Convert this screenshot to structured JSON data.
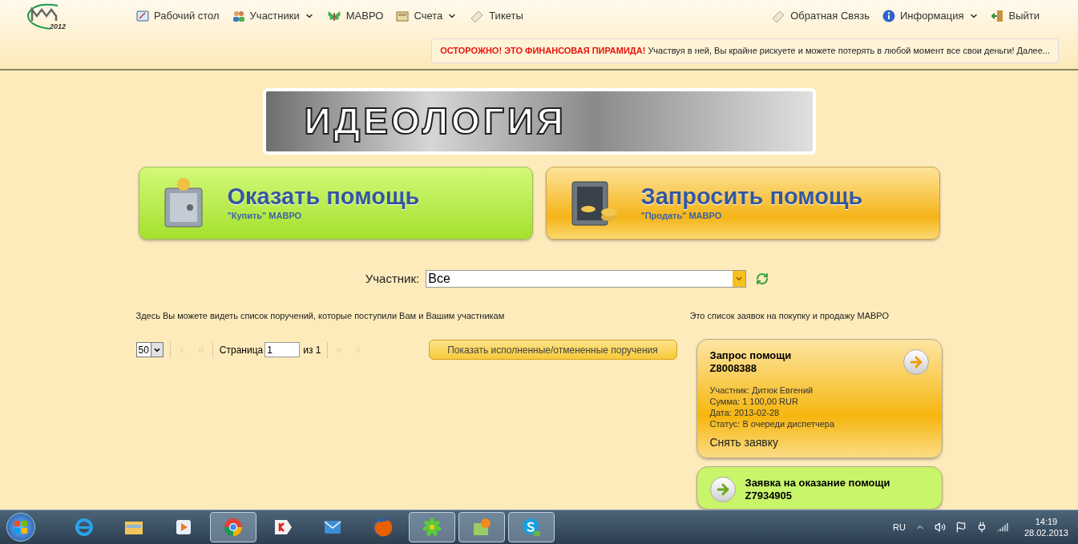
{
  "logo": {
    "year": "2012"
  },
  "nav_left": [
    {
      "label": "Рабочий стол",
      "dropdown": false
    },
    {
      "label": "Участники",
      "dropdown": true
    },
    {
      "label": "МАВРО",
      "dropdown": false
    },
    {
      "label": "Счета",
      "dropdown": true
    },
    {
      "label": "Тикеты",
      "dropdown": false
    }
  ],
  "nav_right": [
    {
      "label": "Обратная Связь",
      "dropdown": false
    },
    {
      "label": "Информация",
      "dropdown": true
    },
    {
      "label": "Выйти",
      "dropdown": false
    }
  ],
  "warning": {
    "alert": "ОСТОРОЖНО! ЭТО ФИНАНСОВАЯ ПИРАМИДА!",
    "text": "Участвуя в ней, Вы крайне рискуете и можете потерять в любой момент все свои деньги! Далее..."
  },
  "banner": {
    "title": "ИДЕОЛОГИЯ"
  },
  "actions": [
    {
      "kind": "give",
      "title": "Оказать помощь",
      "subtitle": "\"Купить\" МАВРО"
    },
    {
      "kind": "ask",
      "title": "Запросить помощь",
      "subtitle": "\"Продать\" МАВРО"
    }
  ],
  "participant_filter": {
    "label": "Участник:",
    "value": "Все"
  },
  "orders": {
    "description": "Здесь Вы можете видеть список поручений, которые поступили Вам и Вашим участникам",
    "page_size": "50",
    "page_label": "Страница",
    "page": "1",
    "of": "из 1",
    "show_done_button": "Показать исполненные/отмененные поручения"
  },
  "requests": {
    "description": "Это список заявок на покупку и продажу МАВРО",
    "items": [
      {
        "kind": "ask",
        "title": "Запрос помощи",
        "number": "Z8008388",
        "details": [
          "Участник: Дитюк Евгений",
          "Сумма: 1 100,00 RUR",
          "Дата: 2013-02-28",
          "Статус: В очереди диспетчера"
        ],
        "cancel": "Снять заявку"
      },
      {
        "kind": "give",
        "title": "Заявка на оказание помощи",
        "number": "Z7934905"
      }
    ]
  },
  "taskbar": {
    "apps": [
      {
        "kind": "ie",
        "open": false
      },
      {
        "kind": "folder",
        "open": false
      },
      {
        "kind": "media",
        "open": false
      },
      {
        "kind": "chrome",
        "open": true
      },
      {
        "kind": "yandex",
        "open": false
      },
      {
        "kind": "mail",
        "open": false
      },
      {
        "kind": "firefox",
        "open": false
      },
      {
        "kind": "icq",
        "open": true
      },
      {
        "kind": "maps",
        "open": true
      },
      {
        "kind": "skype",
        "open": true
      }
    ],
    "language": "RU",
    "time": "14:19",
    "date": "28.02.2013"
  }
}
